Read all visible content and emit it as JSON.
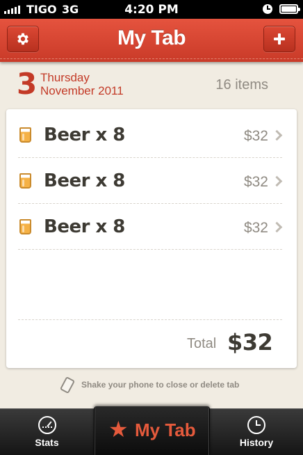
{
  "status_bar": {
    "carrier": "TIGO",
    "network": "3G",
    "time": "4:20 PM"
  },
  "header": {
    "title": "My Tab",
    "settings_icon": "gear-icon",
    "add_icon": "plus-icon"
  },
  "date": {
    "day_number": "3",
    "weekday": "Thursday",
    "month_year": "November 2011"
  },
  "items_count": "16 items",
  "items": [
    {
      "name": "Beer x 8",
      "price": "$32",
      "icon": "beer-glass-icon"
    },
    {
      "name": "Beer x 8",
      "price": "$32",
      "icon": "beer-glass-icon"
    },
    {
      "name": "Beer x 8",
      "price": "$32",
      "icon": "beer-glass-icon"
    }
  ],
  "total": {
    "label": "Total",
    "value": "$32"
  },
  "shake_hint": "Shake your phone to close or delete tab",
  "tabbar": {
    "stats": "Stats",
    "my_tab": "My Tab",
    "history": "History"
  },
  "colors": {
    "accent": "#d4432f",
    "background": "#f1ece2",
    "text_dark": "#3d3a33",
    "text_muted": "#8f8a82"
  }
}
